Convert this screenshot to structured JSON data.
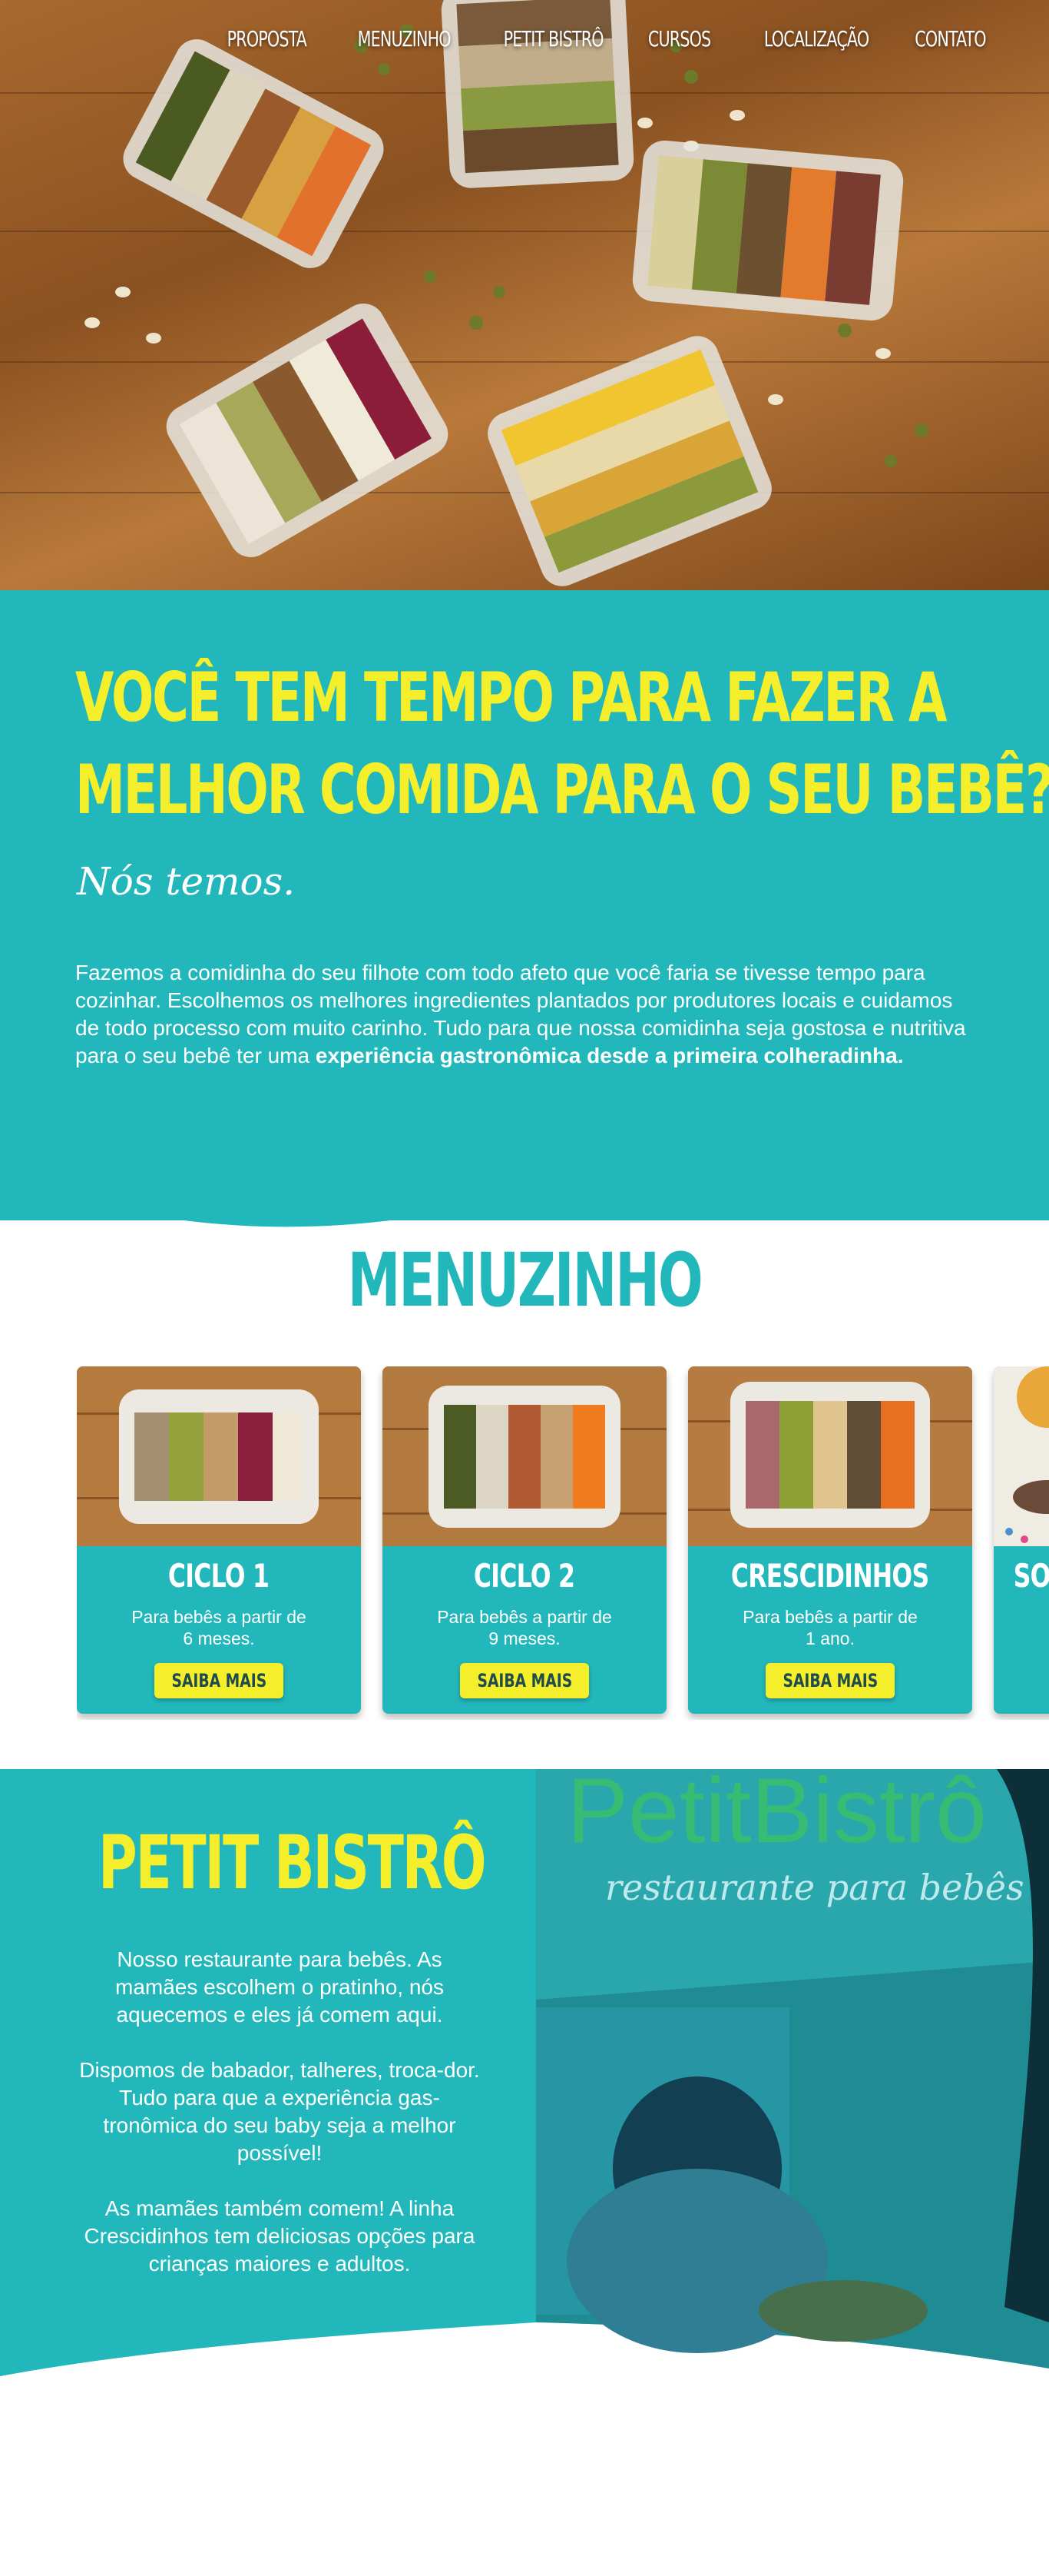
{
  "nav": {
    "items": [
      "PROPOSTA",
      "MENUZINHO",
      "PETIT BISTRÔ",
      "CURSOS",
      "LOCALIZAÇÃO",
      "CONTATO"
    ]
  },
  "intro": {
    "headline_line1": "VOCÊ TEM TEMPO PARA FAZER A",
    "headline_line2": "MELHOR COMIDA PARA O SEU BEBÊ?",
    "tagline": "Nós temos.",
    "paragraph": "Fazemos a comidinha do seu filhote com todo afeto que você faria se tivesse tempo para cozinhar. Escolhemos os melhores ingredientes plantados por produtores locais e cuidamos de todo processo com muito carinho. Tudo para que nossa comidinha seja gostosa e nutritiva para o seu bebê ter uma ",
    "paragraph_bold": "experiência gastronômica desde a primeira colheradinha."
  },
  "menu": {
    "title": "MENUZINHO",
    "cards": [
      {
        "title": "CICLO 1",
        "desc_line1": "Para bebês a partir de",
        "desc_line2": "6 meses.",
        "button": "SAIBA MAIS"
      },
      {
        "title": "CICLO 2",
        "desc_line1": "Para bebês a partir de",
        "desc_line2": "9 meses.",
        "button": "SAIBA MAIS"
      },
      {
        "title": "CRESCIDINHOS",
        "desc_line1": "Para bebês a partir de",
        "desc_line2": "1 ano.",
        "button": "SAIBA MAIS"
      },
      {
        "title": "SOP",
        "desc_line1": "",
        "desc_line2": "",
        "button": ""
      }
    ]
  },
  "bistro": {
    "title": "PETIT BISTRÔ",
    "p1": "Nosso restaurante para bebês. As mamães escolhem o pratinho, nós aquecemos e eles já comem aqui.",
    "p2": "Dispomos de babador, talheres, troca-dor. Tudo para que a experiência gas-tronômica do seu baby seja a melhor possível!",
    "p3": "As mamães também comem! A linha Crescidinhos tem deliciosas opções para crianças maiores e adultos.",
    "photo_sign_line1": "PetitBistrô",
    "photo_sign_line2": "restaurante para bebês"
  },
  "colors": {
    "teal": "#22b7bb",
    "yellow": "#f4ef2a",
    "white": "#ffffff"
  }
}
